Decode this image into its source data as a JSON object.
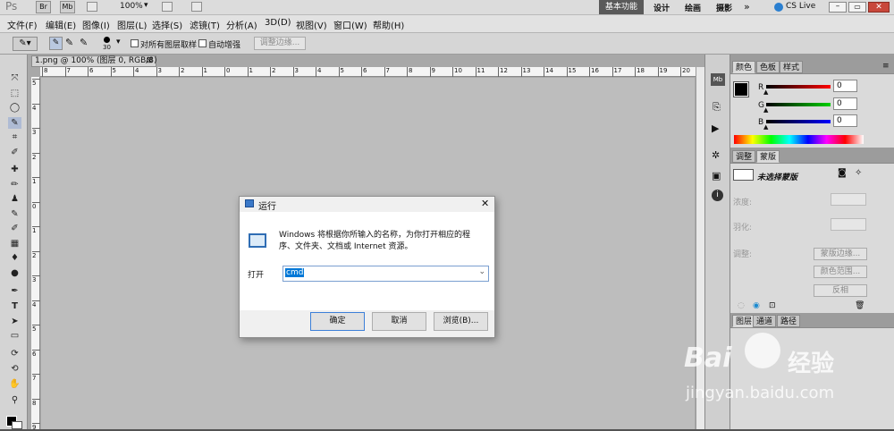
{
  "appbar": {
    "logo": "Ps",
    "bridge": "Br",
    "minibridge": "Mb",
    "zoom": "100%",
    "workspaces": [
      "基本功能",
      "设计",
      "绘画",
      "摄影"
    ],
    "more": "»",
    "cslive": "CS Live"
  },
  "menu": [
    "文件(F)",
    "编辑(E)",
    "图像(I)",
    "图层(L)",
    "选择(S)",
    "滤镜(T)",
    "分析(A)",
    "3D(D)",
    "视图(V)",
    "窗口(W)",
    "帮助(H)"
  ],
  "options": {
    "brush_size": "30",
    "sample_all": "对所有图层取样",
    "auto_enhance": "自动增强",
    "refine_edge": "调整边缘..."
  },
  "document": {
    "tab_title": "1.png @ 100% (图层 0, RGB/8)",
    "close": "⊠"
  },
  "ruler": {
    "h": [
      "8",
      "7",
      "6",
      "5",
      "4",
      "3",
      "2",
      "1",
      "0",
      "1",
      "2",
      "3",
      "4",
      "5",
      "6",
      "7",
      "8",
      "9",
      "10",
      "11",
      "12",
      "13",
      "14",
      "15",
      "16",
      "17",
      "18",
      "19",
      "20"
    ],
    "v": [
      "5",
      "4",
      "3",
      "2",
      "1",
      "0",
      "1",
      "2",
      "3",
      "4",
      "5",
      "6",
      "7",
      "8",
      "9"
    ]
  },
  "color_panel": {
    "tabs": [
      "颜色",
      "色板",
      "样式"
    ],
    "channels": [
      {
        "label": "R",
        "value": "0",
        "color": "#c00000"
      },
      {
        "label": "G",
        "value": "0",
        "color": "#00a000"
      },
      {
        "label": "B",
        "value": "0",
        "color": "#0000c0"
      }
    ]
  },
  "masks_panel": {
    "tabs": [
      "调整",
      "蒙版"
    ],
    "no_selection": "未选择蒙版",
    "density": "浓度:",
    "feather": "羽化:",
    "refine": "调整:",
    "buttons": [
      "蒙版边缘...",
      "颜色范围...",
      "反相"
    ]
  },
  "layers_panel": {
    "tabs": [
      "图层",
      "通道",
      "路径"
    ]
  },
  "dialog": {
    "title": "运行",
    "description": "Windows 将根据你所输入的名称，为你打开相应的程序、文件夹、文档或 Internet 资源。",
    "open_label": "打开",
    "input_value": "cmd",
    "ok": "确定",
    "cancel": "取消",
    "browse": "浏览(B)..."
  },
  "watermark": {
    "brand": "Bai",
    "brand2": "经验",
    "url": "jingyan.baidu.com"
  }
}
